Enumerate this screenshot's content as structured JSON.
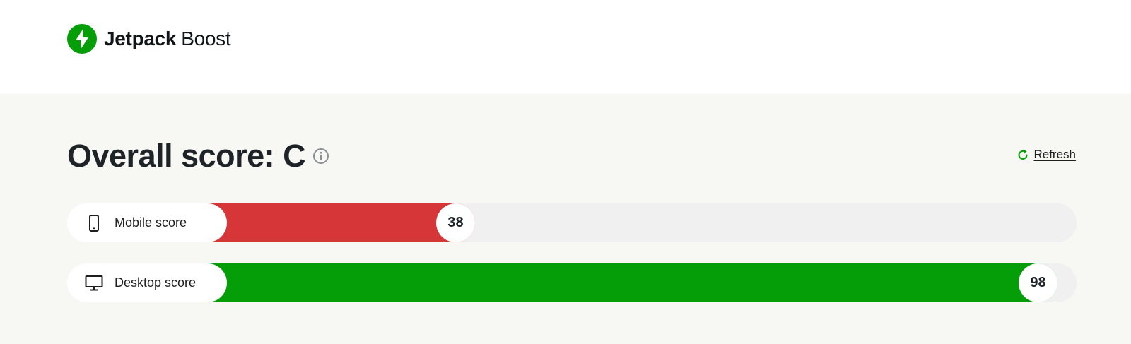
{
  "header": {
    "brand_strong": "Jetpack",
    "brand_light": "Boost",
    "logo_icon": "jetpack-bolt-icon",
    "brand_color": "#069e08"
  },
  "main": {
    "title": "Overall score: C",
    "info_icon": "info-icon",
    "refresh_label": "Refresh",
    "refresh_icon": "refresh-icon"
  },
  "scores": {
    "max": 100,
    "mobile": {
      "label": "Mobile score",
      "value": 38,
      "icon": "mobile-phone-icon",
      "color": "#d63638"
    },
    "desktop": {
      "label": "Desktop score",
      "value": 98,
      "icon": "desktop-monitor-icon",
      "color": "#069e08"
    }
  }
}
